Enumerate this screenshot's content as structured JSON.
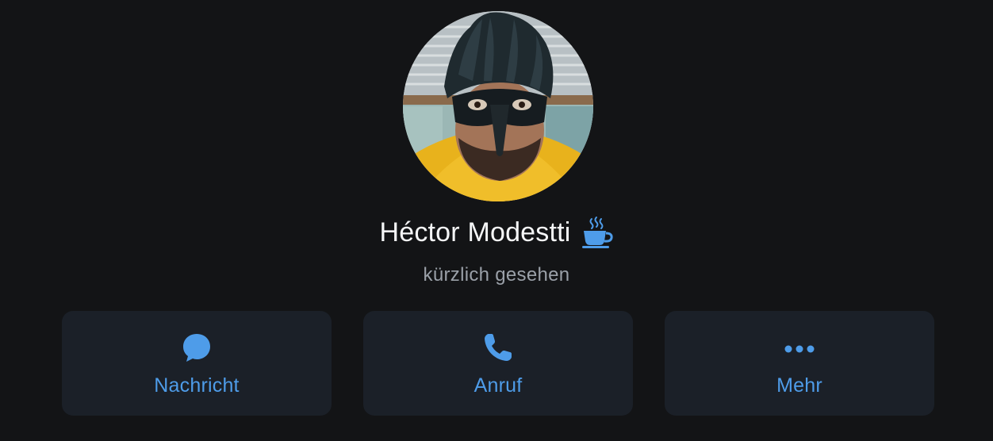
{
  "profile": {
    "name": "Héctor Modestti",
    "status": "kürzlich gesehen",
    "avatar_icon": "profile-photo-masked-person",
    "status_emoji_icon": "hot-beverage-icon"
  },
  "actions": [
    {
      "label": "Nachricht",
      "icon": "message-bubble-icon"
    },
    {
      "label": "Anruf",
      "icon": "phone-icon"
    },
    {
      "label": "Mehr",
      "icon": "more-dots-icon"
    }
  ],
  "colors": {
    "background": "#131416",
    "button_bg": "#1b2028",
    "accent": "#4e9ce9",
    "name_text": "#f5f6f7",
    "secondary_text": "#9aa0a8"
  }
}
